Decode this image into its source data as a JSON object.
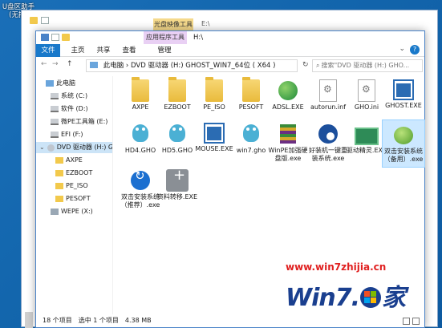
{
  "desktop": {
    "label": "U盘区助手(无损)"
  },
  "background_window": {
    "ribbon_context_tab": "光盘映像工具",
    "path": "E:\\"
  },
  "window": {
    "context_tab": "应用程序工具",
    "title": "H:\\",
    "tabs": [
      "文件",
      "主页",
      "共享",
      "查看",
      "管理"
    ],
    "nav": {
      "back": "←",
      "forward": "→",
      "up": "↑"
    },
    "address": [
      "此电脑",
      "DVD 驱动器 (H:) GHOST_WIN7_64位 ( X64 )"
    ],
    "search_placeholder": "搜索\"DVD 驱动器 (H:) GHO...",
    "sidebar": [
      {
        "label": "此电脑",
        "icon": "pc-icon"
      },
      {
        "label": "系统 (C:)",
        "icon": "drive-icon"
      },
      {
        "label": "软件 (D:)",
        "icon": "drive-icon"
      },
      {
        "label": "微PE工具箱 (E:)",
        "icon": "drive-icon"
      },
      {
        "label": "EFI (F:)",
        "icon": "drive-icon"
      },
      {
        "label": "DVD 驱动器 (H:) G",
        "icon": "dvd-icon"
      },
      {
        "label": "AXPE",
        "icon": "folder-icon"
      },
      {
        "label": "EZBOOT",
        "icon": "folder-icon"
      },
      {
        "label": "PE_ISO",
        "icon": "folder-icon"
      },
      {
        "label": "PESOFT",
        "icon": "folder-icon"
      },
      {
        "label": "WEPE (X:)",
        "icon": "network-icon"
      }
    ],
    "files": [
      {
        "name": "AXPE",
        "icon": "folder"
      },
      {
        "name": "EZBOOT",
        "icon": "folder"
      },
      {
        "name": "PE_ISO",
        "icon": "folder"
      },
      {
        "name": "PESOFT",
        "icon": "folder"
      },
      {
        "name": "ADSL.EXE",
        "icon": "globe"
      },
      {
        "name": "autorun.inf",
        "icon": "inf"
      },
      {
        "name": "GHO.ini",
        "icon": "inf"
      },
      {
        "name": "GHOST.EXE",
        "icon": "exeblue"
      },
      {
        "name": "HD4.GHO",
        "icon": "ghost"
      },
      {
        "name": "HD5.GHO",
        "icon": "ghost"
      },
      {
        "name": "MOUSE.EXE",
        "icon": "exeblue"
      },
      {
        "name": "win7.gho",
        "icon": "ghost"
      },
      {
        "name": "WinPE加强硬盘版.exe",
        "icon": "winpe"
      },
      {
        "name": "好装机一键重装系统.exe",
        "icon": "eye"
      },
      {
        "name": "驱动精灵.EXE",
        "icon": "card"
      },
      {
        "name": "双击安装系统（备用）.exe",
        "icon": "greenball"
      },
      {
        "name": "双击安装系统（推荐）.exe",
        "icon": "bluecircle"
      },
      {
        "name": "资料转移.EXE",
        "icon": "greybox"
      }
    ],
    "status": {
      "count": "18 个项目",
      "selected": "选中 1 个项目",
      "size": "4.38 MB"
    }
  },
  "watermark": {
    "url": "www.win7zhijia.cn",
    "brand": "Win7之家"
  }
}
